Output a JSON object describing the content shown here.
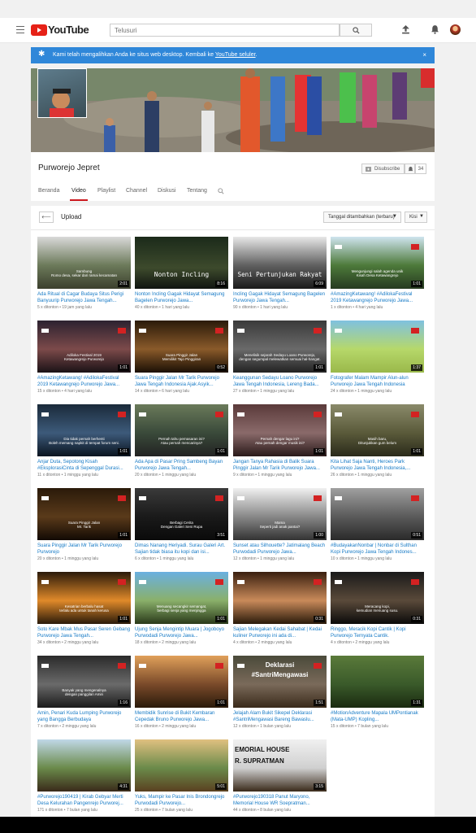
{
  "header": {
    "logo_text": "YouTube",
    "search_placeholder": "Telusuri"
  },
  "alert": {
    "text": "Kami telah mengalihkan Anda ke situs web desktop. Kembali ke ",
    "link": "YouTube seluler",
    "suffix": ".",
    "close": "×"
  },
  "channel": {
    "name": "Purworejo Jepret",
    "unsubscribe_label": "Disubscribe",
    "subscriber_count": "34"
  },
  "tabs": [
    "Beranda",
    "Video",
    "Playlist",
    "Channel",
    "Diskusi",
    "Tentang"
  ],
  "active_tab": "Video",
  "content": {
    "uploads_label": "Upload",
    "sort_label": "Tanggal ditambahkan (terbaru)",
    "grid_label": "Kisi"
  },
  "colors": {
    "brand_red": "#e62117",
    "alert_blue": "#2f87d9",
    "link_blue": "#167ac6",
    "meta_gray": "#767676"
  },
  "videos": [
    {
      "title": "Ada Ritual di Cagar Budaya Situs Perigi Banyuurip Purworejo Jawa Tengah...",
      "views": "5 x ditonton",
      "age": "19 jam yang lalu",
      "duration": "2:01",
      "caption": "Sambung\nRomo desa, sekar dari ramai kecamatan"
    },
    {
      "title": "Nonton Incling Gagak Hidayat Semagung Bagelen Purworejo Jawa...",
      "views": "40 x ditonton",
      "age": "1 hari yang lalu",
      "duration": "8:16",
      "caption": "Nonton Incling"
    },
    {
      "title": "Incling Gagak Hidayat Semagung Bagelen Purworejo Jawa Tengah...",
      "views": "90 x ditonton",
      "age": "1 hari yang lalu",
      "duration": "6:09",
      "caption": "Seni Pertunjukan Rakyat"
    },
    {
      "title": "#AmazingKetawang! #AdilokaFestival 2019 Ketawangrejo Purworejo Jawa...",
      "views": "1 x ditonton",
      "age": "4 hari yang lalu",
      "duration": "1:01",
      "caption": "Mengunjungi salah agenda unik\nKisah Desa Ketawangrejo"
    },
    {
      "title": "#AmazingKetawang! #AdilokaFestival 2019 Ketawangrejo Purworejo Jawa...",
      "views": "15 x ditonton",
      "age": "4 hari yang lalu",
      "duration": "1:01",
      "caption": "Adiloka Festival 2019\nKetawangrejo Purworejo"
    },
    {
      "title": "Suara Pinggir Jalan Mr Tarik Purworejo Jawa Tengah Indonesia Ajak Asyik...",
      "views": "14 x ditonton",
      "age": "6 hari yang lalu",
      "duration": "0:52",
      "caption": "Suara Pinggir Jalan\nMemilikit Tajo Pinggiran"
    },
    {
      "title": "Keanggunan Sedayu Loano Purworejo Jawa Tengah Indonesia, Lereng Bada...",
      "views": "27 x ditonton",
      "age": "1 minggu yang lalu",
      "duration": "1:01",
      "caption": "Menelisik sejarah Sedayu Loano Purworejo,\ndengan segumpal melewatkan semuai hal-hangat."
    },
    {
      "title": "Fotografer Malam Mampir Alun-alun Purworejo Jawa Tengah Indonesia",
      "views": "24 x ditonton",
      "age": "1 minggu yang lalu",
      "duration": "1:37",
      "caption": ""
    },
    {
      "title": "Anjar Duta, Sepotong Kisah #EksplorasiCinta di Sepenggal Durasi...",
      "views": "11 x ditonton",
      "age": "1 minggu yang lalu",
      "duration": "1:01",
      "caption": "Dia tidak pernah berhenti\nBoleh memang napkit di tempat forum seni."
    },
    {
      "title": "Ada Apa di Pasar Pring Sambeng Bayan Purworejo Jawa Tengah...",
      "views": "20 x ditonton",
      "age": "1 minggu yang lalu",
      "duration": "1:01",
      "caption": "Pernah tahu pernasaran ini?\nAtau pernah mencarinya?"
    },
    {
      "title": "Jangan Tanya Rahasia di Balik Suara Pinggir Jalan Mr Tarik Purworejo Jawa...",
      "views": "9 x ditonton",
      "age": "1 minggu yang lalu",
      "duration": "1:01",
      "caption": "Pernah dengar lagu ini?\nAtau pernah dengar musik ini?"
    },
    {
      "title": "Kita Lihat Saja Nanti, Heroes Park Purworejo Jawa Tengah Indonesia,...",
      "views": "26 x ditonton",
      "age": "1 minggu yang lalu",
      "duration": "1:01",
      "caption": "Masih baru,\nDitunjukkan gum belum"
    },
    {
      "title": "Suara Pinggir Jalan Mr Tarik Purworejo Purworejo",
      "views": "20 x ditonton",
      "age": "1 minggu yang lalu",
      "duration": "1:01",
      "caption": "Suara Pinggir Jalan\nMr. Tarik"
    },
    {
      "title": "Dimas Nanang Heriyadi. Surau Galeri Art. Sajian tidak biasa itu kopi dan isi...",
      "views": "6 x ditonton",
      "age": "1 minggu yang lalu",
      "duration": "3:51",
      "caption": "Berbagi Cerita\nDengan Galeri Seni Rupa"
    },
    {
      "title": "Sunset atau Silhouette? Jatimalang Beach Purwodadi Purworejo Jawa...",
      "views": "12 x ditonton",
      "age": "1 minggu yang lalu",
      "duration": "1:00",
      "caption": "Mama\nSeperti jadi anak pantai?"
    },
    {
      "title": "#BudayakanNonbar | Nonbar di Sulthan Kopi Purworejo Jawa Tengah Indones...",
      "views": "10 x ditonton",
      "age": "1 minggu yang lalu",
      "duration": "0:51",
      "caption": ""
    },
    {
      "title": "Soto Kare Mbak Mus Pasar Seren Gebang Purworejo Jawa Tengah...",
      "views": "34 x ditonton",
      "age": "2 minggu yang lalu",
      "duration": "1:01",
      "caption": "Kesatrian berbalu hasat\nterlalu ada untuk tanah kerusa"
    },
    {
      "title": "Ujung Senja Mengintip Muara | Jogoboyo Purwodadi Purworejo Jawa...",
      "views": "18 x ditonton",
      "age": "2 minggu yang lalu",
      "duration": "1:01",
      "caption": "Menuang secangkir semangat,\nberbagi senja yang menjingga"
    },
    {
      "title": "Sajian Melegakan Kedai Sahabat | Kedai kuliner Purworejo ini ada di...",
      "views": "4 x ditonton",
      "age": "2 minggu yang lalu",
      "duration": "0:31",
      "caption": ""
    },
    {
      "title": "Ringgo, Meracik Kopi Cantik | Kopi Purworejo Ternyata Cantik.",
      "views": "4 x ditonton",
      "age": "2 minggu yang lalu",
      "duration": "0:31",
      "caption": "Meracang kopi,\nkemudian menuang susu."
    },
    {
      "title": "Amin, Penari Kuda Lumping Purworejo yang Bangga Berbudaya",
      "views": "7 x ditonton",
      "age": "2 minggu yang lalu",
      "duration": "1:16",
      "caption": "Banyak yang mengenalnya\ndengan panggilan Amin"
    },
    {
      "title": "Membidik Sunrise di Bukit Kembaran Cepedak Bruno Purworejo Jawa...",
      "views": "16 x ditonton",
      "age": "2 minggu yang lalu",
      "duration": "1:01",
      "caption": ""
    },
    {
      "title": "Jelajah Alam Bukit Sikepel Deklarasi #SantriMengawasi Bareng Bawaslu...",
      "views": "12 x ditonton",
      "age": "1 bulan yang lalu",
      "duration": "1:51",
      "caption": "Deklarasi\n#SantriMengawasi"
    },
    {
      "title": "#MotionAdventure Mapala UMPontianak (Mata-UMP) Kopling...",
      "views": "15 x ditonton",
      "age": "7 bulan yang lalu",
      "duration": "1:31",
      "caption": ""
    },
    {
      "title": "#Purworejo190419 | Kirab Gebyar Merti Desa Kelurahan Pangenrejo Purworej...",
      "views": "171 x ditonton",
      "age": "7 bulan yang lalu",
      "duration": "4:31",
      "caption": ""
    },
    {
      "title": "Yuks, Mampir ke Pasar Inis Brondongrejo Purwodadi Purworejo...",
      "views": "25 x ditonton",
      "age": "7 bulan yang lalu",
      "duration": "5:01",
      "caption": ""
    },
    {
      "title": "#Purworejo190318 Panut Maryono, Memorial House WR Soepratman...",
      "views": "44 x ditonton",
      "age": "8 bulan yang lalu",
      "duration": "3:15",
      "caption": "EMORIAL HOUSE\nR. SUPRATMAN"
    }
  ]
}
